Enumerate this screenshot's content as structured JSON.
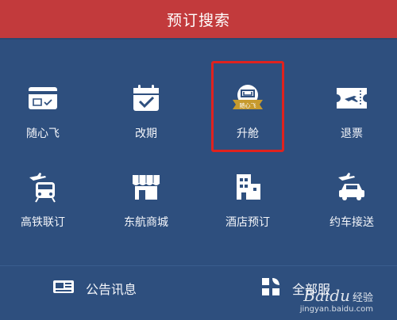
{
  "header": {
    "title": "预订搜索"
  },
  "grid": {
    "row1": [
      {
        "label": "随心飞",
        "icon": "card-icon"
      },
      {
        "label": "改期",
        "icon": "calendar-check-icon"
      },
      {
        "label": "升舱",
        "icon": "upgrade-seat-badge-icon"
      },
      {
        "label": "退票",
        "icon": "ticket-icon"
      }
    ],
    "row2": [
      {
        "label": "高铁联订",
        "icon": "plane-train-icon"
      },
      {
        "label": "东航商城",
        "icon": "store-icon"
      },
      {
        "label": "酒店预订",
        "icon": "hotel-icon"
      },
      {
        "label": "约车接送",
        "icon": "plane-car-icon"
      }
    ]
  },
  "badge_text": "随心飞",
  "bottom": {
    "announcements": {
      "label": "公告讯息",
      "icon": "announcement-icon"
    },
    "all": {
      "label": "全部服",
      "icon": "all-services-icon"
    }
  },
  "watermark": {
    "brand": "Baidu",
    "accent": "经验",
    "url": "jingyan.baidu.com"
  },
  "colors": {
    "header": "#c23a3c",
    "background": "#2e4f7e",
    "highlight": "#e0221e",
    "gold": "#c79a2e"
  }
}
